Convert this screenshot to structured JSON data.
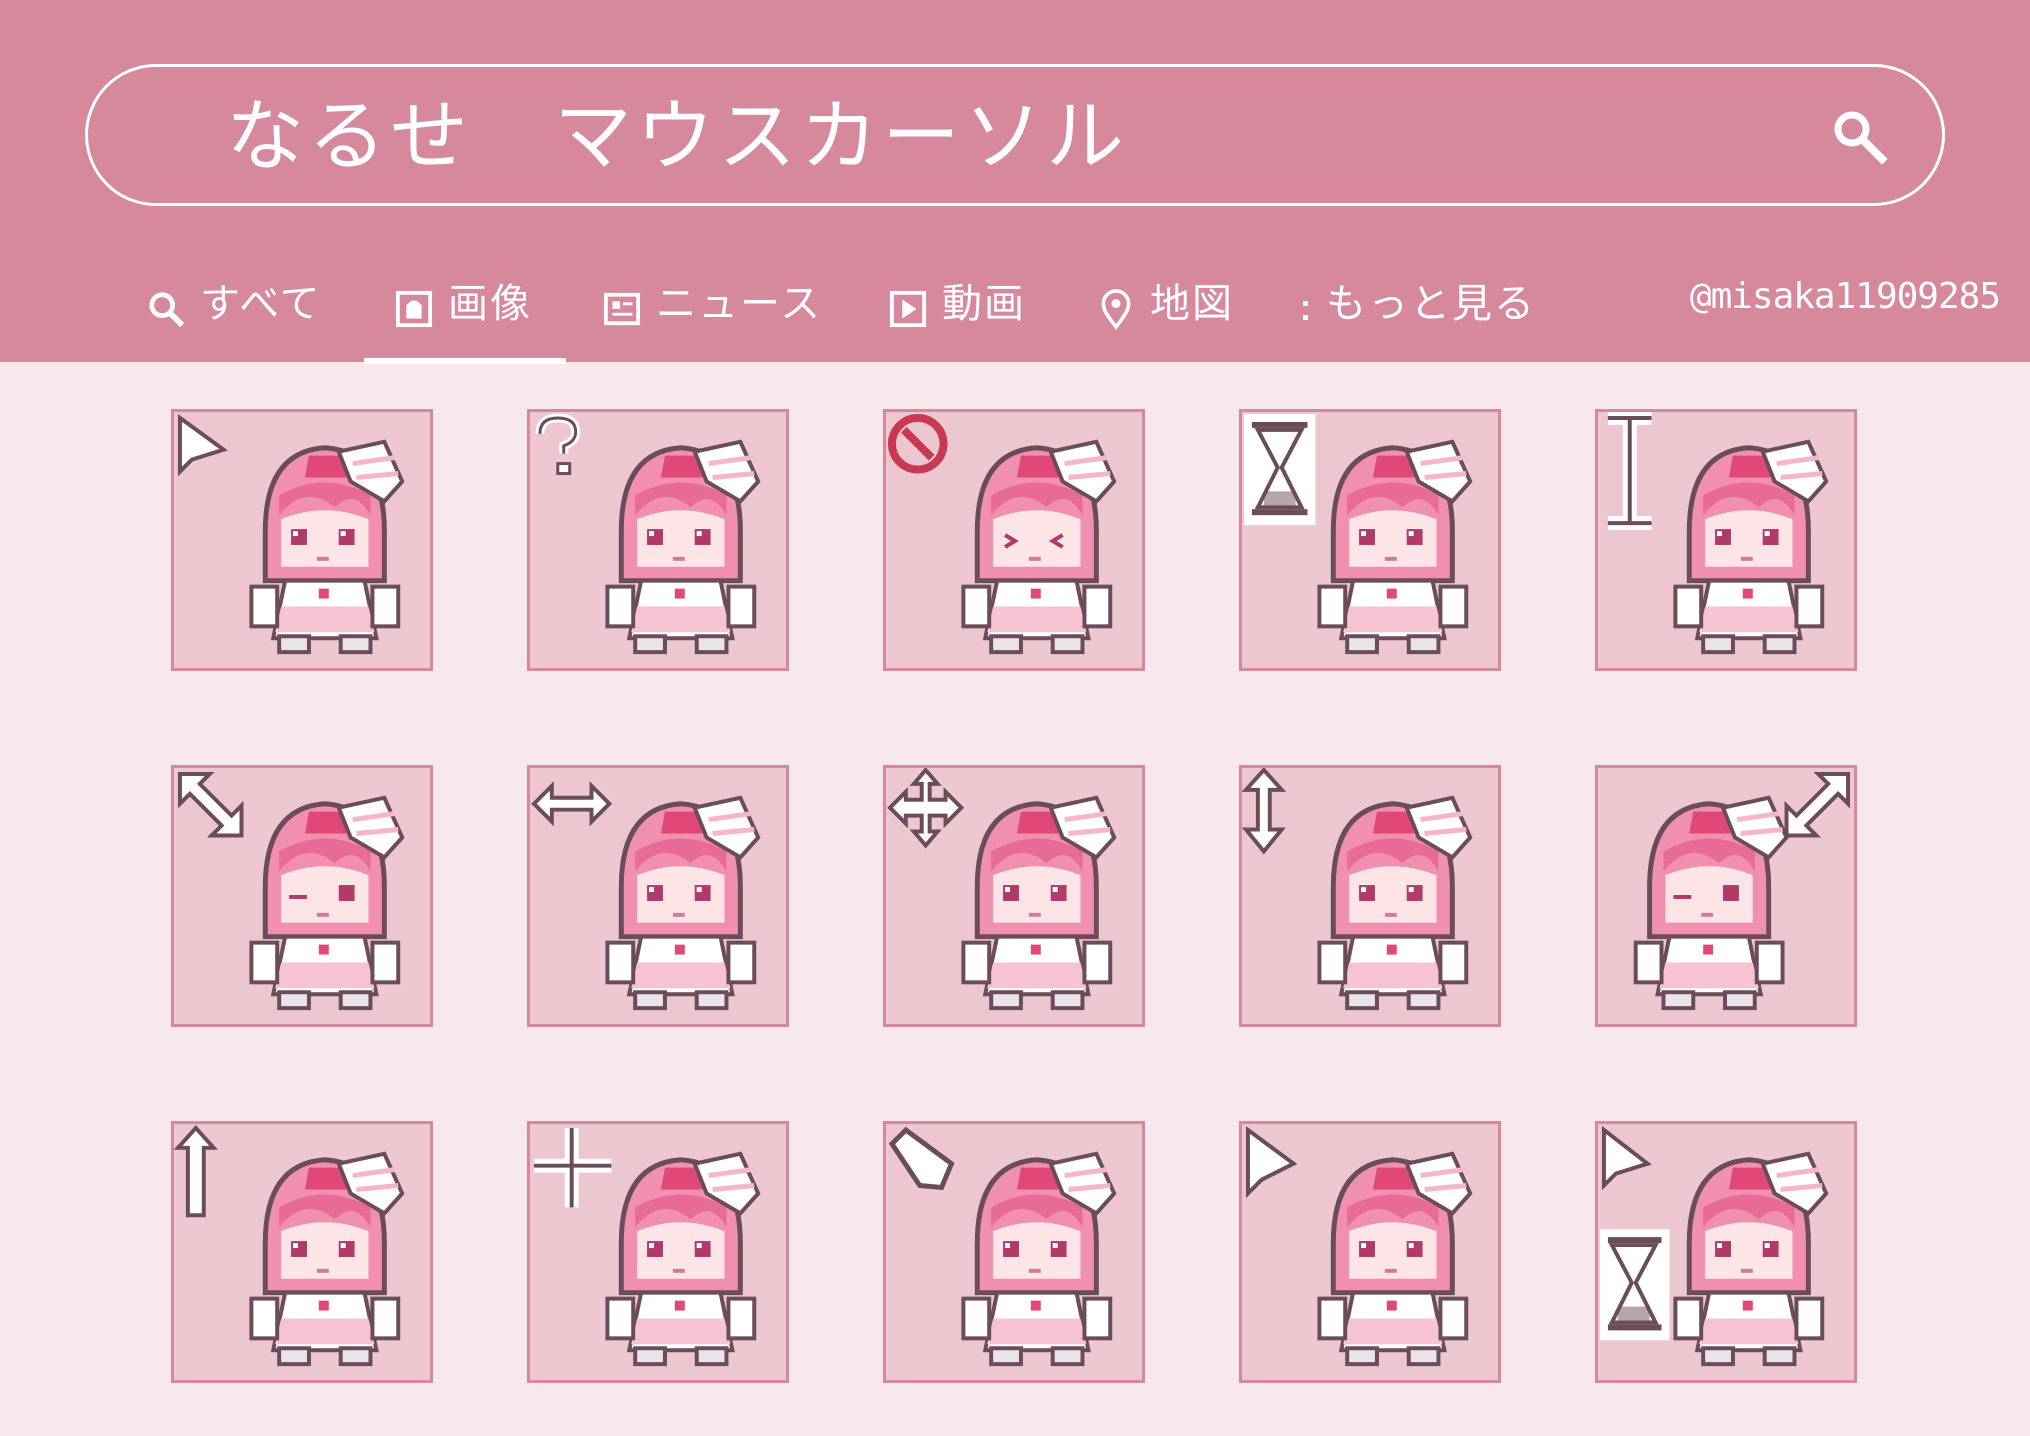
{
  "search": {
    "query": "なるせ　マウスカーソル"
  },
  "tabs": [
    {
      "label": "すべて",
      "icon": "search-icon",
      "active": false
    },
    {
      "label": "画像",
      "icon": "image-icon",
      "active": true
    },
    {
      "label": "ニュース",
      "icon": "news-icon",
      "active": false
    },
    {
      "label": "動画",
      "icon": "video-icon",
      "active": false
    },
    {
      "label": "地図",
      "icon": "map-pin-icon",
      "active": false
    },
    {
      "label": "もっと見る",
      "icon": "more-vertical-icon",
      "active": false
    }
  ],
  "user": {
    "handle": "@misaka11909285"
  },
  "colors": {
    "header": "#d6889c",
    "page": "#f7e8ec",
    "tile": "#ecc7cf",
    "tile_border": "#d6889c"
  },
  "tiles": [
    {
      "cursor": "arrow-cursor-icon",
      "face": "normal"
    },
    {
      "cursor": "help-cursor-icon",
      "face": "normal"
    },
    {
      "cursor": "unavailable-cursor-icon",
      "face": "squint"
    },
    {
      "cursor": "busy-hourglass-cursor-icon",
      "face": "normal"
    },
    {
      "cursor": "text-beam-cursor-icon",
      "face": "normal"
    },
    {
      "cursor": "diagonal-resize-cursor-icon",
      "face": "wink"
    },
    {
      "cursor": "horizontal-resize-cursor-icon",
      "face": "normal"
    },
    {
      "cursor": "move-cursor-icon",
      "face": "normal"
    },
    {
      "cursor": "vertical-resize-cursor-icon",
      "face": "normal"
    },
    {
      "cursor": "diagonal-resize-alt-cursor-icon",
      "face": "wink"
    },
    {
      "cursor": "alternate-select-cursor-icon",
      "face": "normal"
    },
    {
      "cursor": "precision-crosshair-cursor-icon",
      "face": "normal"
    },
    {
      "cursor": "handwriting-pen-cursor-icon",
      "face": "normal"
    },
    {
      "cursor": "link-select-cursor-icon",
      "face": "normal"
    },
    {
      "cursor": "working-in-background-cursor-icon",
      "face": "normal"
    }
  ]
}
